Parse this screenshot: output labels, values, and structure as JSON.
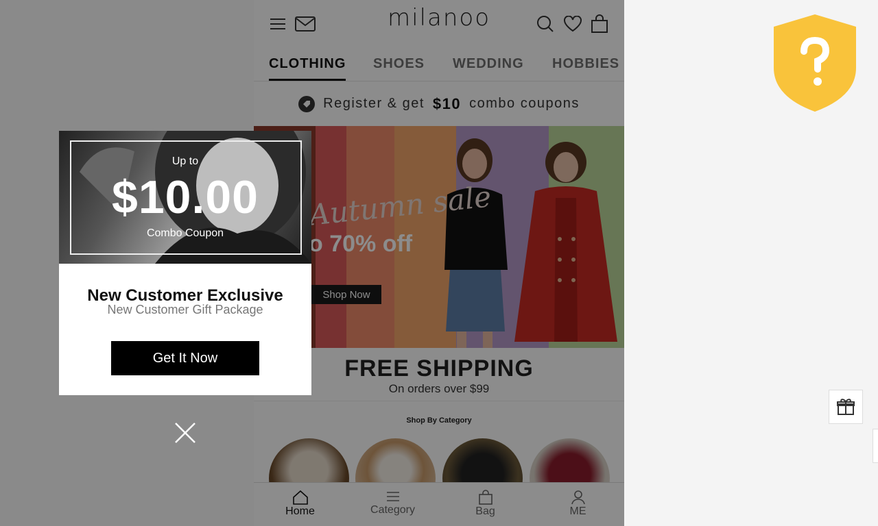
{
  "header": {
    "logo": "milanoo"
  },
  "nav": {
    "items": [
      "CLOTHING",
      "SHOES",
      "WEDDING",
      "HOBBIES"
    ]
  },
  "promo": {
    "prefix": "Register & get",
    "amount": "$10",
    "suffix": "combo coupons"
  },
  "banner": {
    "sale_text": "Autumn sale",
    "off_text": "o 70% off",
    "cta": "Shop Now"
  },
  "shipping": {
    "title": "FREE SHIPPING",
    "subtitle": "On orders over $99"
  },
  "category": {
    "title": "Shop By Category"
  },
  "tabbar": {
    "items": [
      "Home",
      "Category",
      "Bag",
      "ME"
    ]
  },
  "popup": {
    "upto": "Up to",
    "amount": "$10.00",
    "combo": "Combo Coupon",
    "title": "New Customer Exclusive",
    "subtitle": "New Customer Gift Package",
    "button": "Get It Now"
  },
  "colors": {
    "accent": "#000000",
    "shield": "#F9C33B"
  }
}
